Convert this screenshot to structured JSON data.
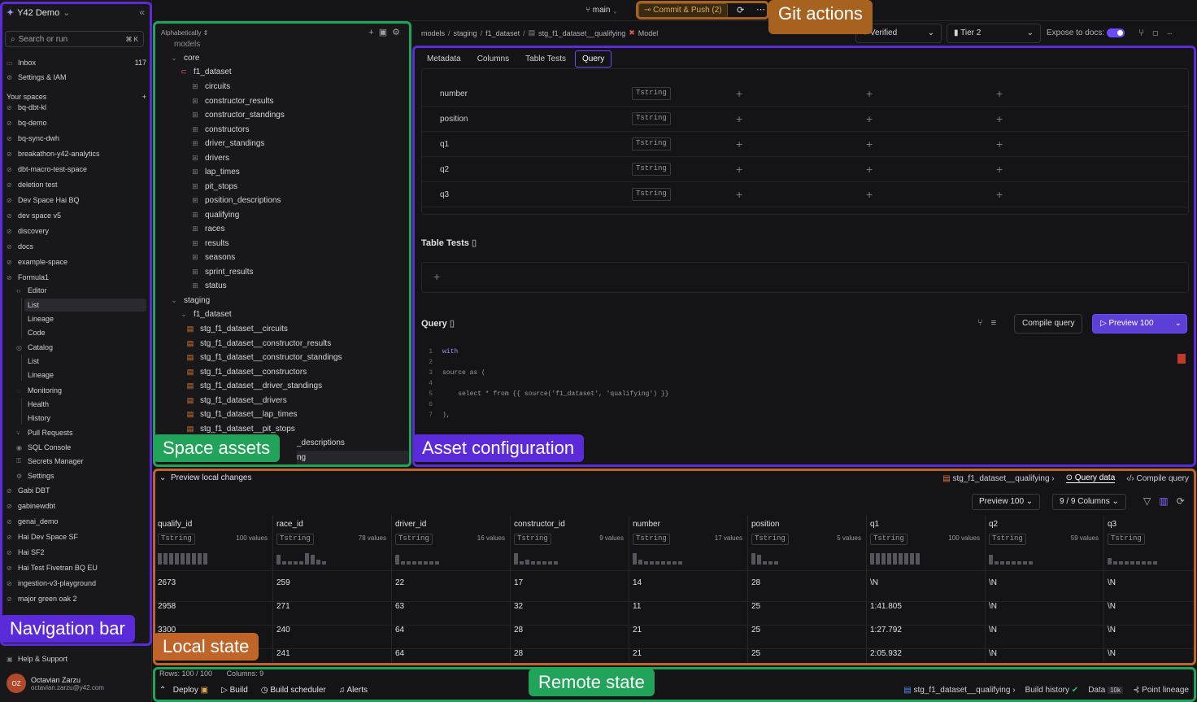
{
  "workspace": "Y42 Demo",
  "search": {
    "placeholder": "Search or run",
    "kbd": "⌘ K"
  },
  "sidebar": {
    "inbox": {
      "label": "Inbox",
      "count": "117"
    },
    "settings_iam": "Settings & IAM",
    "your_spaces": "Your spaces",
    "spaces": [
      "bq-dbt-kl",
      "bq-demo",
      "bq-sync-dwh",
      "breakathon-y42-analytics",
      "dbt-macro-test-space",
      "deletion test",
      "Dev Space Hai BQ",
      "dev space v5",
      "discovery",
      "docs",
      "example-space",
      "Formula1"
    ],
    "formula1": {
      "editor": "Editor",
      "list": "List",
      "lineage": "Lineage",
      "code": "Code",
      "catalog": "Catalog",
      "cat_list": "List",
      "cat_lineage": "Lineage",
      "monitoring": "Monitoring",
      "health": "Health",
      "history": "History",
      "pull_requests": "Pull Requests",
      "sql_console": "SQL Console",
      "secrets_manager": "Secrets Manager",
      "settings": "Settings"
    },
    "spaces2": [
      "Gabi DBT",
      "gabinewdbt",
      "genai_demo",
      "Hai Dev Space SF",
      "Hai SF2",
      "Hai Test Fivetran BQ EU",
      "ingestion-v3-playground",
      "major green oak 2"
    ],
    "help": "Help & Support",
    "user": {
      "initials": "OZ",
      "name": "Octavian Zarzu",
      "email": "octavian.zarzu@y42.com"
    }
  },
  "topbar": {
    "branch": "main",
    "commit": "Commit & Push (2)"
  },
  "tree": {
    "sort": "Alphabetically",
    "models_label": "models",
    "core": "core",
    "f1_dataset": "f1_dataset",
    "core_items": [
      "circuits",
      "constructor_results",
      "constructor_standings",
      "constructors",
      "driver_standings",
      "drivers",
      "lap_times",
      "pit_stops",
      "position_descriptions",
      "qualifying",
      "races",
      "results",
      "seasons",
      "sprint_results",
      "status"
    ],
    "staging": "staging",
    "staging_ds": "f1_dataset",
    "staging_items": [
      "stg_f1_dataset__circuits",
      "stg_f1_dataset__constructor_results",
      "stg_f1_dataset__constructor_standings",
      "stg_f1_dataset__constructors",
      "stg_f1_dataset__driver_standings",
      "stg_f1_dataset__drivers",
      "stg_f1_dataset__lap_times",
      "stg_f1_dataset__pit_stops"
    ],
    "partial1": "_descriptions",
    "partial2": "ng"
  },
  "breadcrumb": {
    "p1": "models",
    "p2": "staging",
    "p3": "f1_dataset",
    "p4": "stg_f1_dataset__qualifying",
    "type": "Model"
  },
  "header_controls": {
    "verified": "Verified",
    "tier": "Tier 2",
    "expose": "Expose to docs:"
  },
  "config": {
    "tabs": [
      "Metadata",
      "Columns",
      "Table Tests",
      "Query"
    ],
    "columns": [
      {
        "name": "number",
        "type": "string"
      },
      {
        "name": "position",
        "type": "string"
      },
      {
        "name": "q1",
        "type": "string"
      },
      {
        "name": "q2",
        "type": "string"
      },
      {
        "name": "q3",
        "type": "string"
      }
    ],
    "table_tests_title": "Table Tests",
    "query_title": "Query",
    "compile": "Compile query",
    "preview": "Preview 100",
    "code": [
      {
        "n": "1",
        "t": "with"
      },
      {
        "n": "2",
        "t": ""
      },
      {
        "n": "3",
        "t": "source as ("
      },
      {
        "n": "4",
        "t": ""
      },
      {
        "n": "5",
        "t": "    select * from {{ source('f1_dataset', 'qualifying') }}"
      },
      {
        "n": "6",
        "t": ""
      },
      {
        "n": "7",
        "t": "),"
      }
    ]
  },
  "preview": {
    "title": "Preview local changes",
    "model": "stg_f1_dataset__qualifying",
    "query_data": "Query data",
    "compile_query": "Compile query",
    "preview_btn": "Preview 100",
    "columns_btn": "9 / 9 Columns",
    "cols": [
      {
        "name": "qualify_id",
        "type": "string",
        "vals": "100 values"
      },
      {
        "name": "race_id",
        "type": "string",
        "vals": "78 values"
      },
      {
        "name": "driver_id",
        "type": "string",
        "vals": "16 values"
      },
      {
        "name": "constructor_id",
        "type": "string",
        "vals": "9 values"
      },
      {
        "name": "number",
        "type": "string",
        "vals": "17 values"
      },
      {
        "name": "position",
        "type": "string",
        "vals": "5 values"
      },
      {
        "name": "q1",
        "type": "string",
        "vals": "100 values"
      },
      {
        "name": "q2",
        "type": "string",
        "vals": "59 values"
      },
      {
        "name": "q3",
        "type": "string",
        "vals": "59 va"
      }
    ],
    "rows": [
      [
        "2673",
        "259",
        "22",
        "17",
        "14",
        "28",
        "\\N",
        "\\N",
        "\\N"
      ],
      [
        "2958",
        "271",
        "63",
        "32",
        "11",
        "25",
        "1:41.805",
        "\\N",
        "\\N"
      ],
      [
        "3300",
        "240",
        "64",
        "28",
        "21",
        "25",
        "1:27.792",
        "\\N",
        "\\N"
      ],
      [
        "",
        "241",
        "64",
        "28",
        "21",
        "25",
        "2:05.932",
        "\\N",
        "\\N"
      ]
    ]
  },
  "status": {
    "rows": "Rows: 100 / 100",
    "columns": "Columns: 9",
    "deploy": "Deploy",
    "build": "Build",
    "scheduler": "Build scheduler",
    "alerts": "Alerts",
    "model": "stg_f1_dataset__qualifying",
    "history": "Build history",
    "data": "Data",
    "data_badge": "10k",
    "lineage": "Point lineage"
  },
  "annotations": {
    "git": "Git actions",
    "space_assets": "Space assets",
    "asset_config": "Asset configuration",
    "nav_bar": "Navigation bar",
    "local_state": "Local state",
    "remote_state": "Remote state"
  },
  "colors": {
    "nav": "#5b2bd9",
    "space": "#22a35a",
    "config": "#5b2bd9",
    "local": "#c0652a",
    "git": "#a8621f",
    "remote": "#22a35a"
  }
}
